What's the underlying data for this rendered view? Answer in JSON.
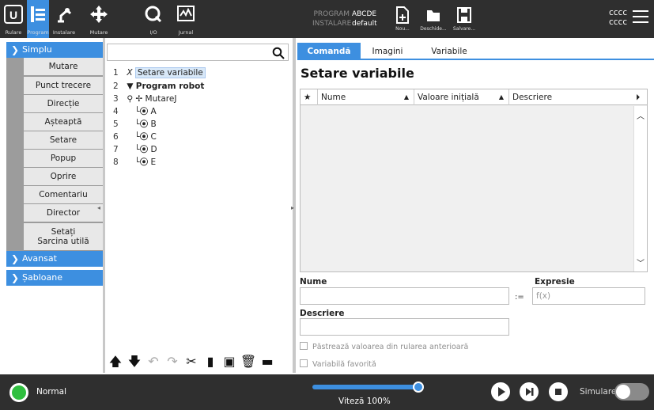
{
  "header": {
    "tabs": [
      {
        "label": "Rulare",
        "icon": "run-logo-icon"
      },
      {
        "label": "Program",
        "icon": "program-icon",
        "active": true
      },
      {
        "label": "Instalare",
        "icon": "robot-arm-icon"
      },
      {
        "label": "Mutare",
        "icon": "move-cross-icon"
      },
      {
        "label": "I/O",
        "icon": "io-icon"
      },
      {
        "label": "Jurnal",
        "icon": "log-icon"
      }
    ],
    "program_key": "PROGRAM",
    "program_value": "ABCDE",
    "install_key": "INSTALARE",
    "install_value": "default",
    "file_buttons": [
      {
        "label": "Nou...",
        "icon": "new-file-icon"
      },
      {
        "label": "Deschide...",
        "icon": "open-folder-icon"
      },
      {
        "label": "Salvare...",
        "icon": "save-icon"
      }
    ],
    "user_line1": "cccc",
    "user_line2": "cccc"
  },
  "categories": {
    "simplu": "Simplu",
    "avansat": "Avansat",
    "sabloane": "Șabloane"
  },
  "simple_items": [
    "Mutare",
    "Punct trecere",
    "Direcție",
    "Așteaptă",
    "Setare",
    "Popup",
    "Oprire",
    "Comentariu",
    "Director"
  ],
  "simple_item_last": [
    "Setați",
    "Sarcina utilă"
  ],
  "search": {
    "placeholder": ""
  },
  "tree": [
    {
      "num": "1",
      "icon": "X",
      "label": "Setare variabile"
    },
    {
      "num": "2",
      "icon": "▼",
      "label": "Program robot"
    },
    {
      "num": "3",
      "icon": "⚲ ✢",
      "label": "MutareJ"
    },
    {
      "num": "4",
      "icon": "⦿",
      "label": "A"
    },
    {
      "num": "5",
      "icon": "⦿",
      "label": "B"
    },
    {
      "num": "6",
      "icon": "⦿",
      "label": "C"
    },
    {
      "num": "7",
      "icon": "⦿",
      "label": "D"
    },
    {
      "num": "8",
      "icon": "⦿",
      "label": "E"
    }
  ],
  "tree_tools": [
    "move-up-icon",
    "move-down-icon",
    "undo-icon",
    "redo-icon",
    "cut-icon",
    "copy-icon",
    "paste-icon",
    "delete-icon",
    "suppress-icon"
  ],
  "right_tabs": [
    "Comandă",
    "Imagini",
    "Variabile"
  ],
  "panel_title": "Setare variabile",
  "grid_headers": {
    "star": "★",
    "name": "Nume",
    "initial": "Valoare inițială",
    "desc": "Descriere"
  },
  "form": {
    "name_label": "Nume",
    "expr_label": "Expresie",
    "assign": ":=",
    "expr_placeholder": "f(x)",
    "desc_label": "Descriere",
    "keep_value": "Păstrează valoarea din rularea anterioară",
    "favorite": "Variabilă favorită"
  },
  "footer": {
    "status": "Normal",
    "speed_label": "Viteză 100%",
    "speed_percent": 100,
    "simulation": "Simulare",
    "simulation_on": false
  }
}
